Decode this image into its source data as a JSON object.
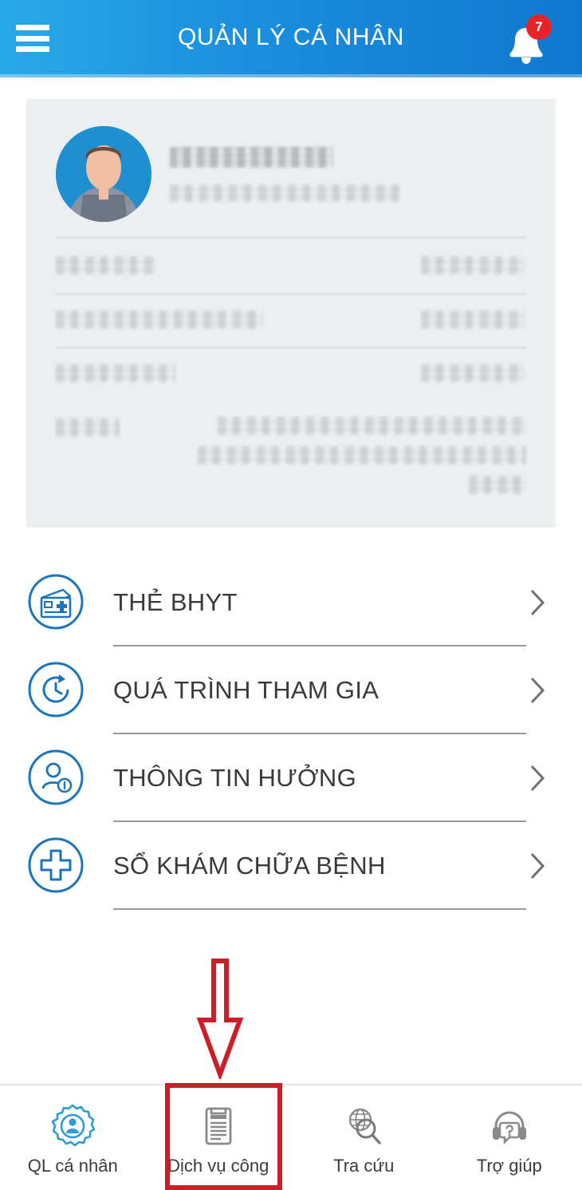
{
  "header": {
    "title": "QUẢN LÝ CÁ NHÂN",
    "menu_icon": "hamburger-menu-icon",
    "notification_icon": "bell-icon",
    "notification_count": "7",
    "gradient_start": "#29A9E9",
    "gradient_end": "#1077CF"
  },
  "profile_card": {
    "avatar_icon": "user-avatar-photo",
    "name": "",
    "subtitle": "",
    "rows": [
      {
        "label": "",
        "value": ""
      },
      {
        "label": "",
        "value": ""
      },
      {
        "label": "",
        "value": ""
      },
      {
        "label": "",
        "value": ""
      }
    ],
    "redacted": "true",
    "background_color": "#ECEFF0"
  },
  "menu": {
    "items": [
      {
        "label": "THẺ BHYT",
        "icon": "insurance-card-icon",
        "chevron": "chevron-right-icon"
      },
      {
        "label": "QUÁ TRÌNH THAM GIA",
        "icon": "history-clock-refresh-icon",
        "chevron": "chevron-right-icon"
      },
      {
        "label": "THÔNG TIN HƯỞNG",
        "icon": "person-info-icon",
        "chevron": "chevron-right-icon"
      },
      {
        "label": "SỔ KHÁM CHỮA BỆNH",
        "icon": "medical-cross-icon",
        "chevron": "chevron-right-icon"
      }
    ],
    "icon_color": "#1B75BC",
    "text_color": "#3A3A3A"
  },
  "annotation": {
    "arrow_icon": "down-arrow-annotation",
    "arrow_color": "#CC1E28",
    "highlight_target": "Dịch vụ công",
    "highlight_color": "#CC1E28"
  },
  "bottom_nav": {
    "items": [
      {
        "label": "QL cá nhân",
        "icon": "person-gear-badge-icon",
        "active": "true"
      },
      {
        "label": "Dịch vụ công",
        "icon": "clipboard-document-icon",
        "active": "false"
      },
      {
        "label": "Tra cứu",
        "icon": "globe-search-icon",
        "active": "false"
      },
      {
        "label": "Trợ giúp",
        "icon": "headset-help-icon",
        "active": "false"
      }
    ],
    "active_color": "#2D9BD6",
    "inactive_color": "#7A7A7A"
  }
}
